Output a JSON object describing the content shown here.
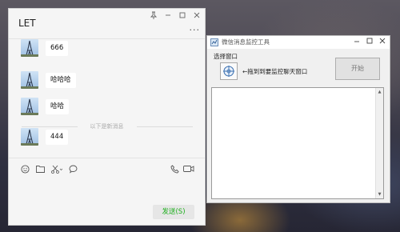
{
  "chat": {
    "title": "LET",
    "controls": [
      "pin-icon",
      "minimize-icon",
      "maximize-icon",
      "close-icon"
    ],
    "more_label": "···",
    "messages": [
      {
        "text": "666"
      },
      {
        "text": "哈哈哈"
      },
      {
        "text": "哈哈"
      }
    ],
    "divider_text": "以下是新消息",
    "new_messages": [
      {
        "text": "444"
      }
    ],
    "toolbar_icons": [
      "emoji-icon",
      "folder-icon",
      "screenshot-icon",
      "chat-history-icon",
      "phone-icon",
      "video-icon"
    ],
    "send_label": "发送(S)",
    "accent": "#1aad19"
  },
  "monitor": {
    "title": "微信消息监控工具",
    "select_label": "选择窗口",
    "hint": "←拖到到要监控聊天窗口",
    "start_label": "开始",
    "icons": [
      "app-icon",
      "crosshair-icon"
    ]
  }
}
